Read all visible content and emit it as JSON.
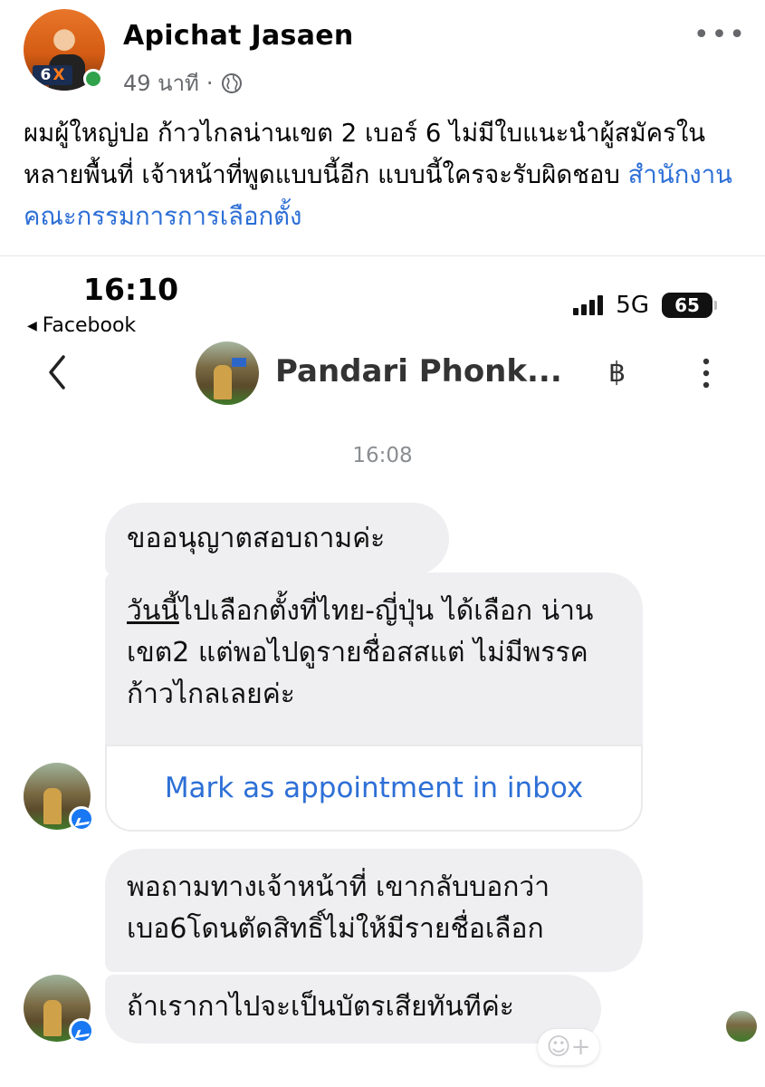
{
  "post": {
    "author_name": "Apichat Jasaen",
    "avatar_badge_number": "6",
    "avatar_badge_x": "X",
    "time_ago": "49 นาที",
    "meta_separator": "·",
    "text": "ผมผู้ใหญ่ปอ ก้าวไกลน่านเขต 2 เบอร์ 6 ไม่มีใบแนะนำผู้สมัครในหลายพื้นที่ เจ้าหน้าที่พูดแบบนี้อีก แบบนี้ใครจะรับผิดชอบ ",
    "link_text": "สำนักงานคณะกรรมการการเลือกตั้ง",
    "more_label": "•••"
  },
  "status_bar": {
    "time": "16:10",
    "back_app": "Facebook",
    "network": "5G",
    "battery": "65"
  },
  "chat": {
    "contact_name": "Pandari Phonk...",
    "baht_symbol": "฿",
    "timestamp": "16:08",
    "messages": {
      "m1": "ขออนุญาตสอบถามค่ะ",
      "m2_underlined": "วันนี้",
      "m2_rest": "ไปเลือกตั้งที่ไทย-ญี่ปุ่น ได้เลือก น่านเขต2 แต่พอไปดูรายชื่อสสแต่ ไม่มีพรรคก้าวไกลเลยค่ะ",
      "appointment_action": "Mark as appointment in inbox",
      "m3": "พอถามทางเจ้าหน้าที่ เขากลับบอกว่า เบอ6โดนตัดสิทธิ์ไม่ให้มีรายชื่อเลือก",
      "m4": "ถ้าเรากาไปจะเป็นบัตรเสียทันทีค่ะ"
    },
    "reaction_add": "☺+"
  },
  "colors": {
    "link_blue": "#2d6fd6",
    "bubble_gray": "#efeff1",
    "meta_gray": "#65676b",
    "online_green": "#31a24c",
    "messenger_blue": "#1877f2"
  }
}
